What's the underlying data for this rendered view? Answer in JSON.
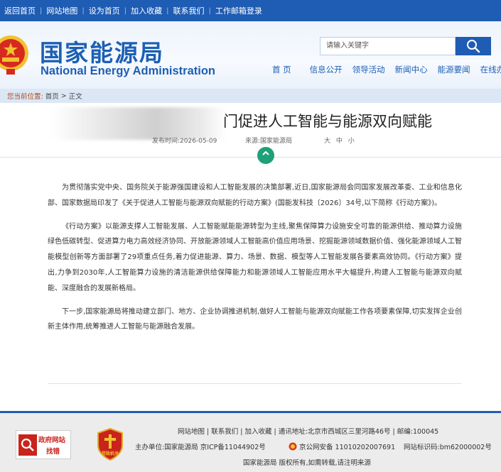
{
  "topbar": {
    "links": [
      "返回首页",
      "网站地图",
      "设为首页",
      "加入收藏",
      "联系我们",
      "工作邮箱登录"
    ]
  },
  "header": {
    "logo_cn": "国家能源局",
    "logo_en": "National Energy Administration",
    "search_placeholder": "请输入关键字",
    "nav": [
      "首 页",
      "信息公开",
      "领导活动",
      "新闻中心",
      "能源要闻",
      "在线办事"
    ]
  },
  "breadcrumb": {
    "label": "您当前位置:",
    "home": "首页",
    "sep": ">",
    "current": "正文"
  },
  "article": {
    "title_visible": "门促进人工智能与能源双向赋能",
    "date": "发布时间:2026-05-09",
    "source": "来源:国家能源局",
    "font_size_label": "大 中 小",
    "paragraphs": [
      "为贯彻落实党中央、国务院关于能源强国建设和人工智能发展的决策部署,近日,国家能源局会同国家发展改革委、工业和信息化部、国家数据局印发了《关于促进人工智能与能源双向赋能的行动方案》(国能发科技〔2026〕34号,以下简称《行动方案》)。",
      "《行动方案》以能源支撑人工智能发展、人工智能赋能能源转型为主线,聚焦保障算力设施安全可靠的能源供给、推动算力设施绿色低碳转型、促进算力电力高效经济协同、开放能源领域人工智能高价值应用场景、挖掘能源领域数据价值、强化能源领域人工智能模型创新等方面部署了29项重点任务,着力促进能源、算力、场景、数据、模型等人工智能发展各要素高效协同。《行动方案》提出,力争到2030年,人工智能算力设施的清洁能源供给保障能力和能源领域人工智能应用水平大幅提升,构建人工智能与能源双向赋能、深度融合的发展新格局。",
      "下一步,国家能源局将推动建立部门、地方、企业协调推进机制,做好人工智能与能源双向赋能工作各项要素保障,切实发挥企业创新主体作用,统筹推进人工智能与能源融合发展。"
    ]
  },
  "footer": {
    "gov_badge_top": "政府网站",
    "gov_badge_bottom": "找错",
    "party_badge_text": "党政机关",
    "line1": "网站地图 | 联系我们 | 加入收藏 | 通讯地址:北京市西城区三里河路46号 | 邮编:100045",
    "line2_host": "主办单位:国家能源局   京ICP备11044902号",
    "line2_police": "京公网安备 11010202007691",
    "line2_code": "网站标识码:bm62000002号",
    "line3": "国家能源局 版权所有,如需转载,请注明来源"
  },
  "colors": {
    "brand_blue": "#1f5cb3",
    "accent_green": "#1fa078",
    "emblem_red": "#d72a1f"
  }
}
